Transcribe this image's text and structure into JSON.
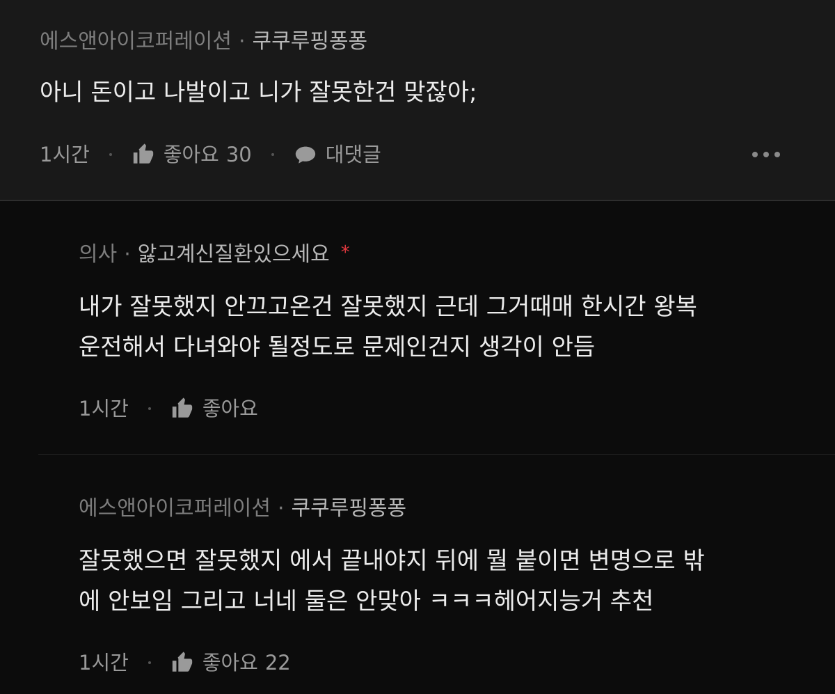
{
  "comments": [
    {
      "org": "에스앤아이코퍼레이션",
      "separator": "·",
      "nickname": "쿠쿠루핑퐁퐁",
      "lines": [
        "아니 돈이고 나발이고 니가 잘못한건 맞잖아;"
      ],
      "time": "1시간",
      "like_label": "좋아요",
      "like_count": "30",
      "reply_label": "대댓글"
    },
    {
      "org": "의사",
      "separator": "·",
      "nickname": "앓고계신질환있으세요",
      "star": "*",
      "lines": [
        "내가 잘못했지 안끄고온건 잘못했지 근데 그거때매 한시간 왕복",
        "운전해서 다녀와야 될정도로 문제인건지 생각이 안듬"
      ],
      "time": "1시간",
      "like_label": "좋아요"
    },
    {
      "org": "에스앤아이코퍼레이션",
      "separator": "·",
      "nickname": "쿠쿠루핑퐁퐁",
      "lines": [
        "잘못했으면 잘못했지 에서 끝내야지 뒤에 뭘 붙이면 변명으로 밖",
        "에 안보임 그리고 너네 둘은 안맞아 ㅋㅋㅋ헤어지능거 추천"
      ],
      "time": "1시간",
      "like_label": "좋아요",
      "like_count": "22"
    }
  ]
}
